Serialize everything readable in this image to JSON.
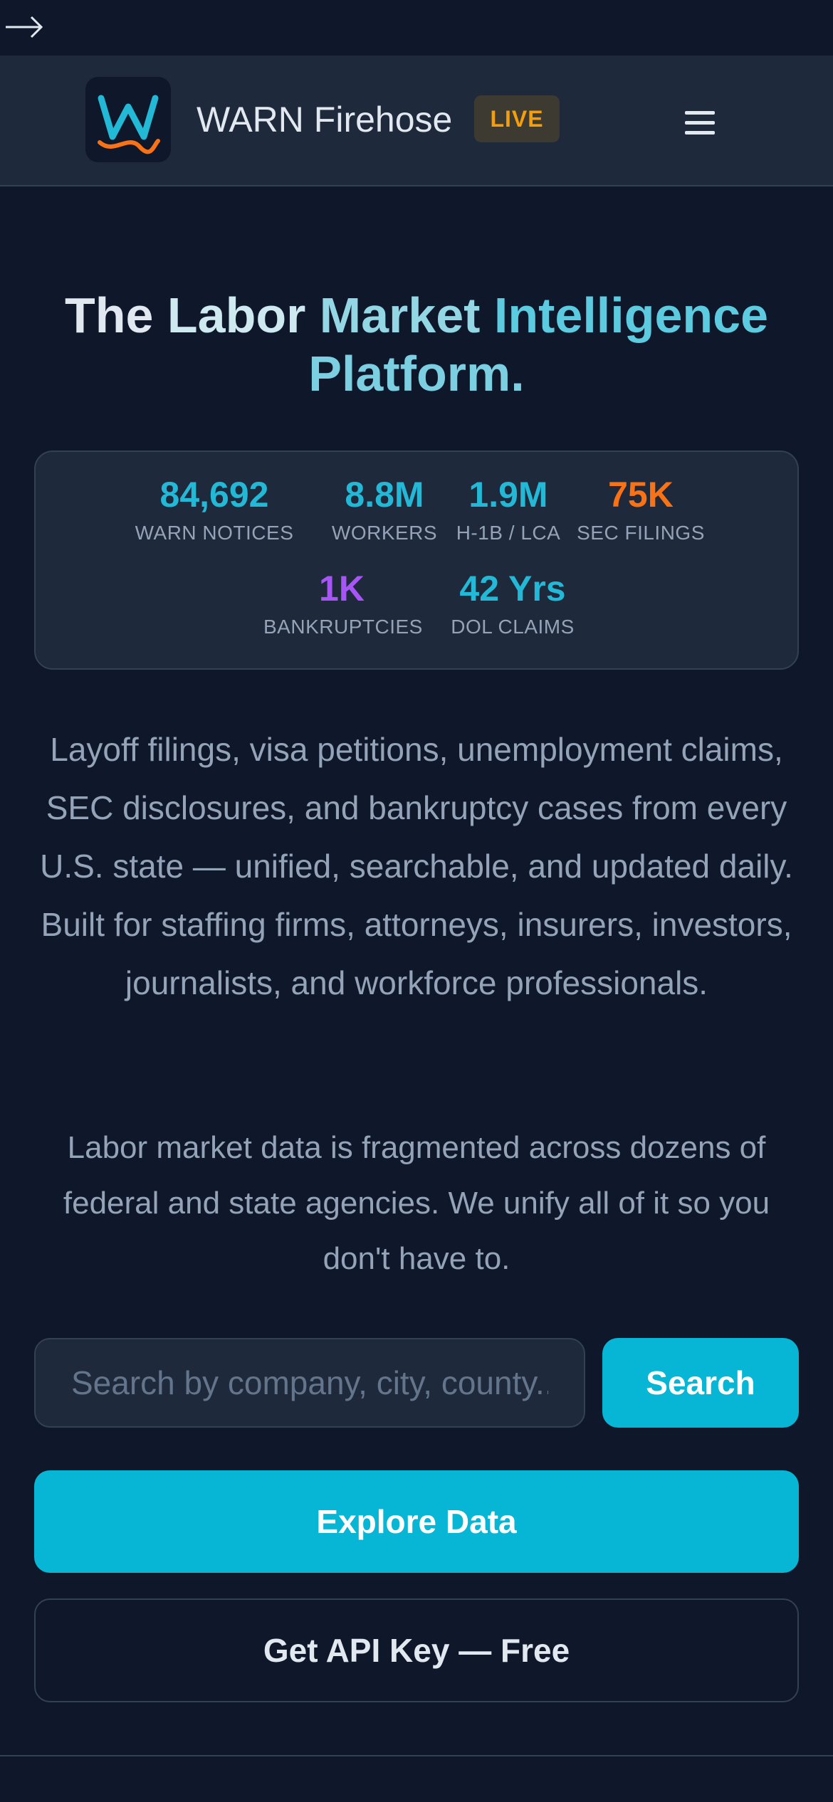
{
  "header": {
    "brand": "WARN Firehose",
    "badge": "LIVE"
  },
  "hero": {
    "title_words": [
      "The",
      "Labor",
      "Market",
      "Intelligence",
      "Platform."
    ]
  },
  "stats": [
    {
      "value": "84,692",
      "label": "WARN NOTICES",
      "color": "#22b8d6"
    },
    {
      "value": "8.8M",
      "label": "WORKERS",
      "color": "#22b8d6"
    },
    {
      "value": "1.9M",
      "label": "H-1B / LCA",
      "color": "#22b8d6"
    },
    {
      "value": "75K",
      "label": "SEC FILINGS",
      "color": "#f97316"
    },
    {
      "value": "1K",
      "label": "BANKRUPTCIES",
      "color": "#a855f7"
    },
    {
      "value": "42 Yrs",
      "label": "DOL CLAIMS",
      "color": "#22b8d6"
    }
  ],
  "description": "Layoff filings, visa petitions, unemployment claims, SEC disclosures, and bankruptcy cases from every U.S. state — unified, searchable, and updated daily. Built for staffing firms, attorneys, insurers, investors, journalists, and workforce professionals.",
  "subdescription": "Labor market data is fragmented across dozens of federal and state agencies. We unify all of it so you don't have to.",
  "search": {
    "placeholder": "Search by company, city, county...",
    "button_label": "Search"
  },
  "cta": {
    "explore_label": "Explore Data",
    "api_label": "Get API Key — Free"
  },
  "colors": {
    "background": "#0f172a",
    "header": "#1e293b",
    "accent": "#06b6d4",
    "badge_text": "#f59e0b"
  }
}
